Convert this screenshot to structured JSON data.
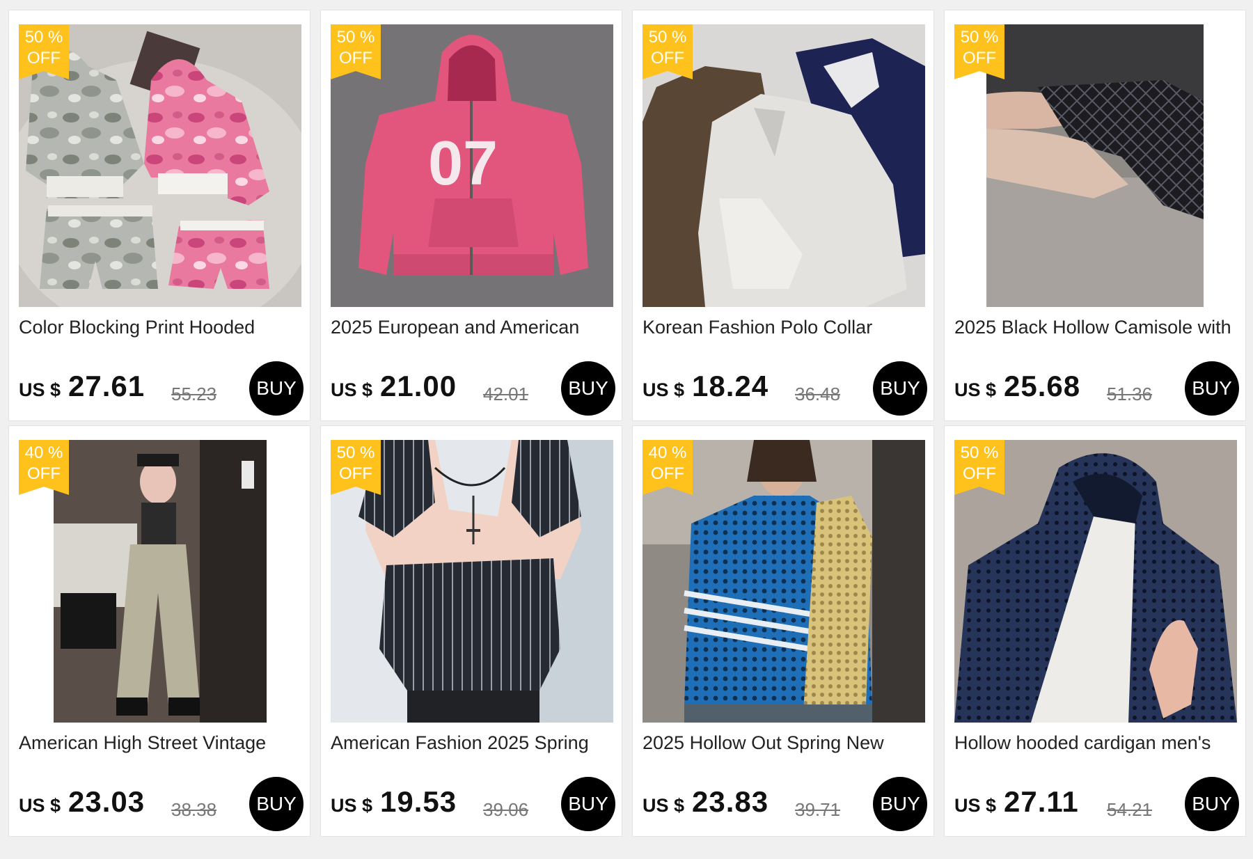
{
  "products": [
    {
      "discount_value": "50 %",
      "discount_label": "OFF",
      "title": "Color Blocking Print Hooded",
      "currency": "US $",
      "price": "27.61",
      "original_price": "55.23",
      "buy_label": "BUY",
      "image_desc": "camo-hoodie-set"
    },
    {
      "discount_value": "50 %",
      "discount_label": "OFF",
      "title": "2025 European and American",
      "currency": "US $",
      "price": "21.00",
      "original_price": "42.01",
      "buy_label": "BUY",
      "image_desc": "pink-07-hoodie"
    },
    {
      "discount_value": "50 %",
      "discount_label": "OFF",
      "title": "Korean Fashion Polo Collar",
      "currency": "US $",
      "price": "18.24",
      "original_price": "36.48",
      "buy_label": "BUY",
      "image_desc": "polo-sweatshirts"
    },
    {
      "discount_value": "50 %",
      "discount_label": "OFF",
      "title": "2025 Black Hollow Camisole with",
      "currency": "US $",
      "price": "25.68",
      "original_price": "51.36",
      "buy_label": "BUY",
      "image_desc": "black-lace-up-camisole"
    },
    {
      "discount_value": "40 %",
      "discount_label": "OFF",
      "title": "American High Street Vintage",
      "currency": "US $",
      "price": "23.03",
      "original_price": "38.38",
      "buy_label": "BUY",
      "image_desc": "vintage-jeans-mirror-selfie"
    },
    {
      "discount_value": "50 %",
      "discount_label": "OFF",
      "title": "American Fashion 2025 Spring",
      "currency": "US $",
      "price": "19.53",
      "original_price": "39.06",
      "buy_label": "BUY",
      "image_desc": "pinstripe-corset-top"
    },
    {
      "discount_value": "40 %",
      "discount_label": "OFF",
      "title": "2025 Hollow Out Spring New",
      "currency": "US $",
      "price": "23.83",
      "original_price": "39.71",
      "buy_label": "BUY",
      "image_desc": "blue-mesh-cardigan"
    },
    {
      "discount_value": "50 %",
      "discount_label": "OFF",
      "title": "Hollow hooded cardigan men's",
      "currency": "US $",
      "price": "27.11",
      "original_price": "54.21",
      "buy_label": "BUY",
      "image_desc": "navy-mesh-hooded-cardigan"
    }
  ],
  "colors": {
    "ribbon": "#ffc21c",
    "buy_button": "#000000",
    "page_background": "#f0f0f0"
  }
}
